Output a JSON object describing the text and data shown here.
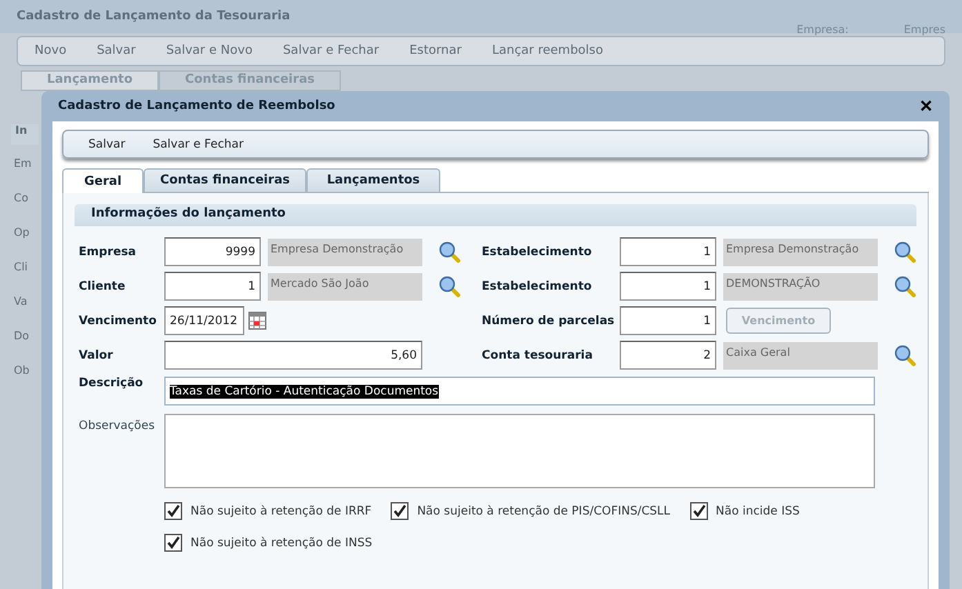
{
  "background_window": {
    "title": "Cadastro de Lançamento da Tesouraria",
    "header_texts": [
      "Empresa:",
      "Empres"
    ],
    "toolbar": [
      "Novo",
      "Salvar",
      "Salvar e Novo",
      "Salvar e Fechar",
      "Estornar",
      "Lançar reembolso"
    ],
    "tabs": [
      {
        "label": "Lançamento",
        "selected": true
      },
      {
        "label": "Contas financeiras",
        "selected": false
      }
    ],
    "section": "In",
    "labels": [
      "Em",
      "Co",
      "Op",
      "Cli",
      "Va",
      "Do",
      "Ob"
    ]
  },
  "dialog": {
    "title": "Cadastro de Lançamento de Reembolso",
    "close": "✕",
    "toolbar": [
      "Salvar",
      "Salvar e Fechar"
    ],
    "tabs": [
      {
        "label": "Geral",
        "selected": true
      },
      {
        "label": "Contas financeiras",
        "selected": false
      },
      {
        "label": "Lançamentos",
        "selected": false
      }
    ],
    "section": "Informações do lançamento",
    "left_fields": [
      {
        "kind": "lookup",
        "label": "Empresa",
        "value": "9999",
        "lookup": "Empresa Demonstração"
      },
      {
        "kind": "lookup",
        "label": "Cliente",
        "value": "1",
        "lookup": "Mercado São João"
      },
      {
        "kind": "date",
        "label": "Vencimento",
        "value": "26/11/2012"
      },
      {
        "kind": "wide",
        "label": "Valor",
        "value": "5,60"
      }
    ],
    "right_fields": [
      {
        "kind": "lookup",
        "label": "Estabelecimento",
        "value": "1",
        "lookup": "Empresa Demonstração"
      },
      {
        "kind": "lookup",
        "label": "Estabelecimento",
        "value": "1",
        "lookup": "DEMONSTRAÇÃO"
      },
      {
        "kind": "button",
        "label": "Número de parcelas",
        "value": "1",
        "button": "Vencimento",
        "disabled": true
      },
      {
        "kind": "lookup",
        "label": "Conta tesouraria",
        "value": "2",
        "lookup": "Caixa Geral"
      }
    ],
    "description": {
      "label": "Descrição",
      "value": "Taxas de Cartório - Autenticação Documentos",
      "selected": true
    },
    "notes": {
      "label": "Observações"
    },
    "checkboxes": [
      {
        "label": "Não sujeito à retenção de IRRF",
        "checked": true
      },
      {
        "label": "Não sujeito à retenção de PIS/COFINS/CSLL",
        "checked": true
      },
      {
        "label": "Não incide ISS",
        "checked": true
      },
      {
        "label": "Não sujeito à retenção de INSS",
        "checked": true
      }
    ]
  }
}
